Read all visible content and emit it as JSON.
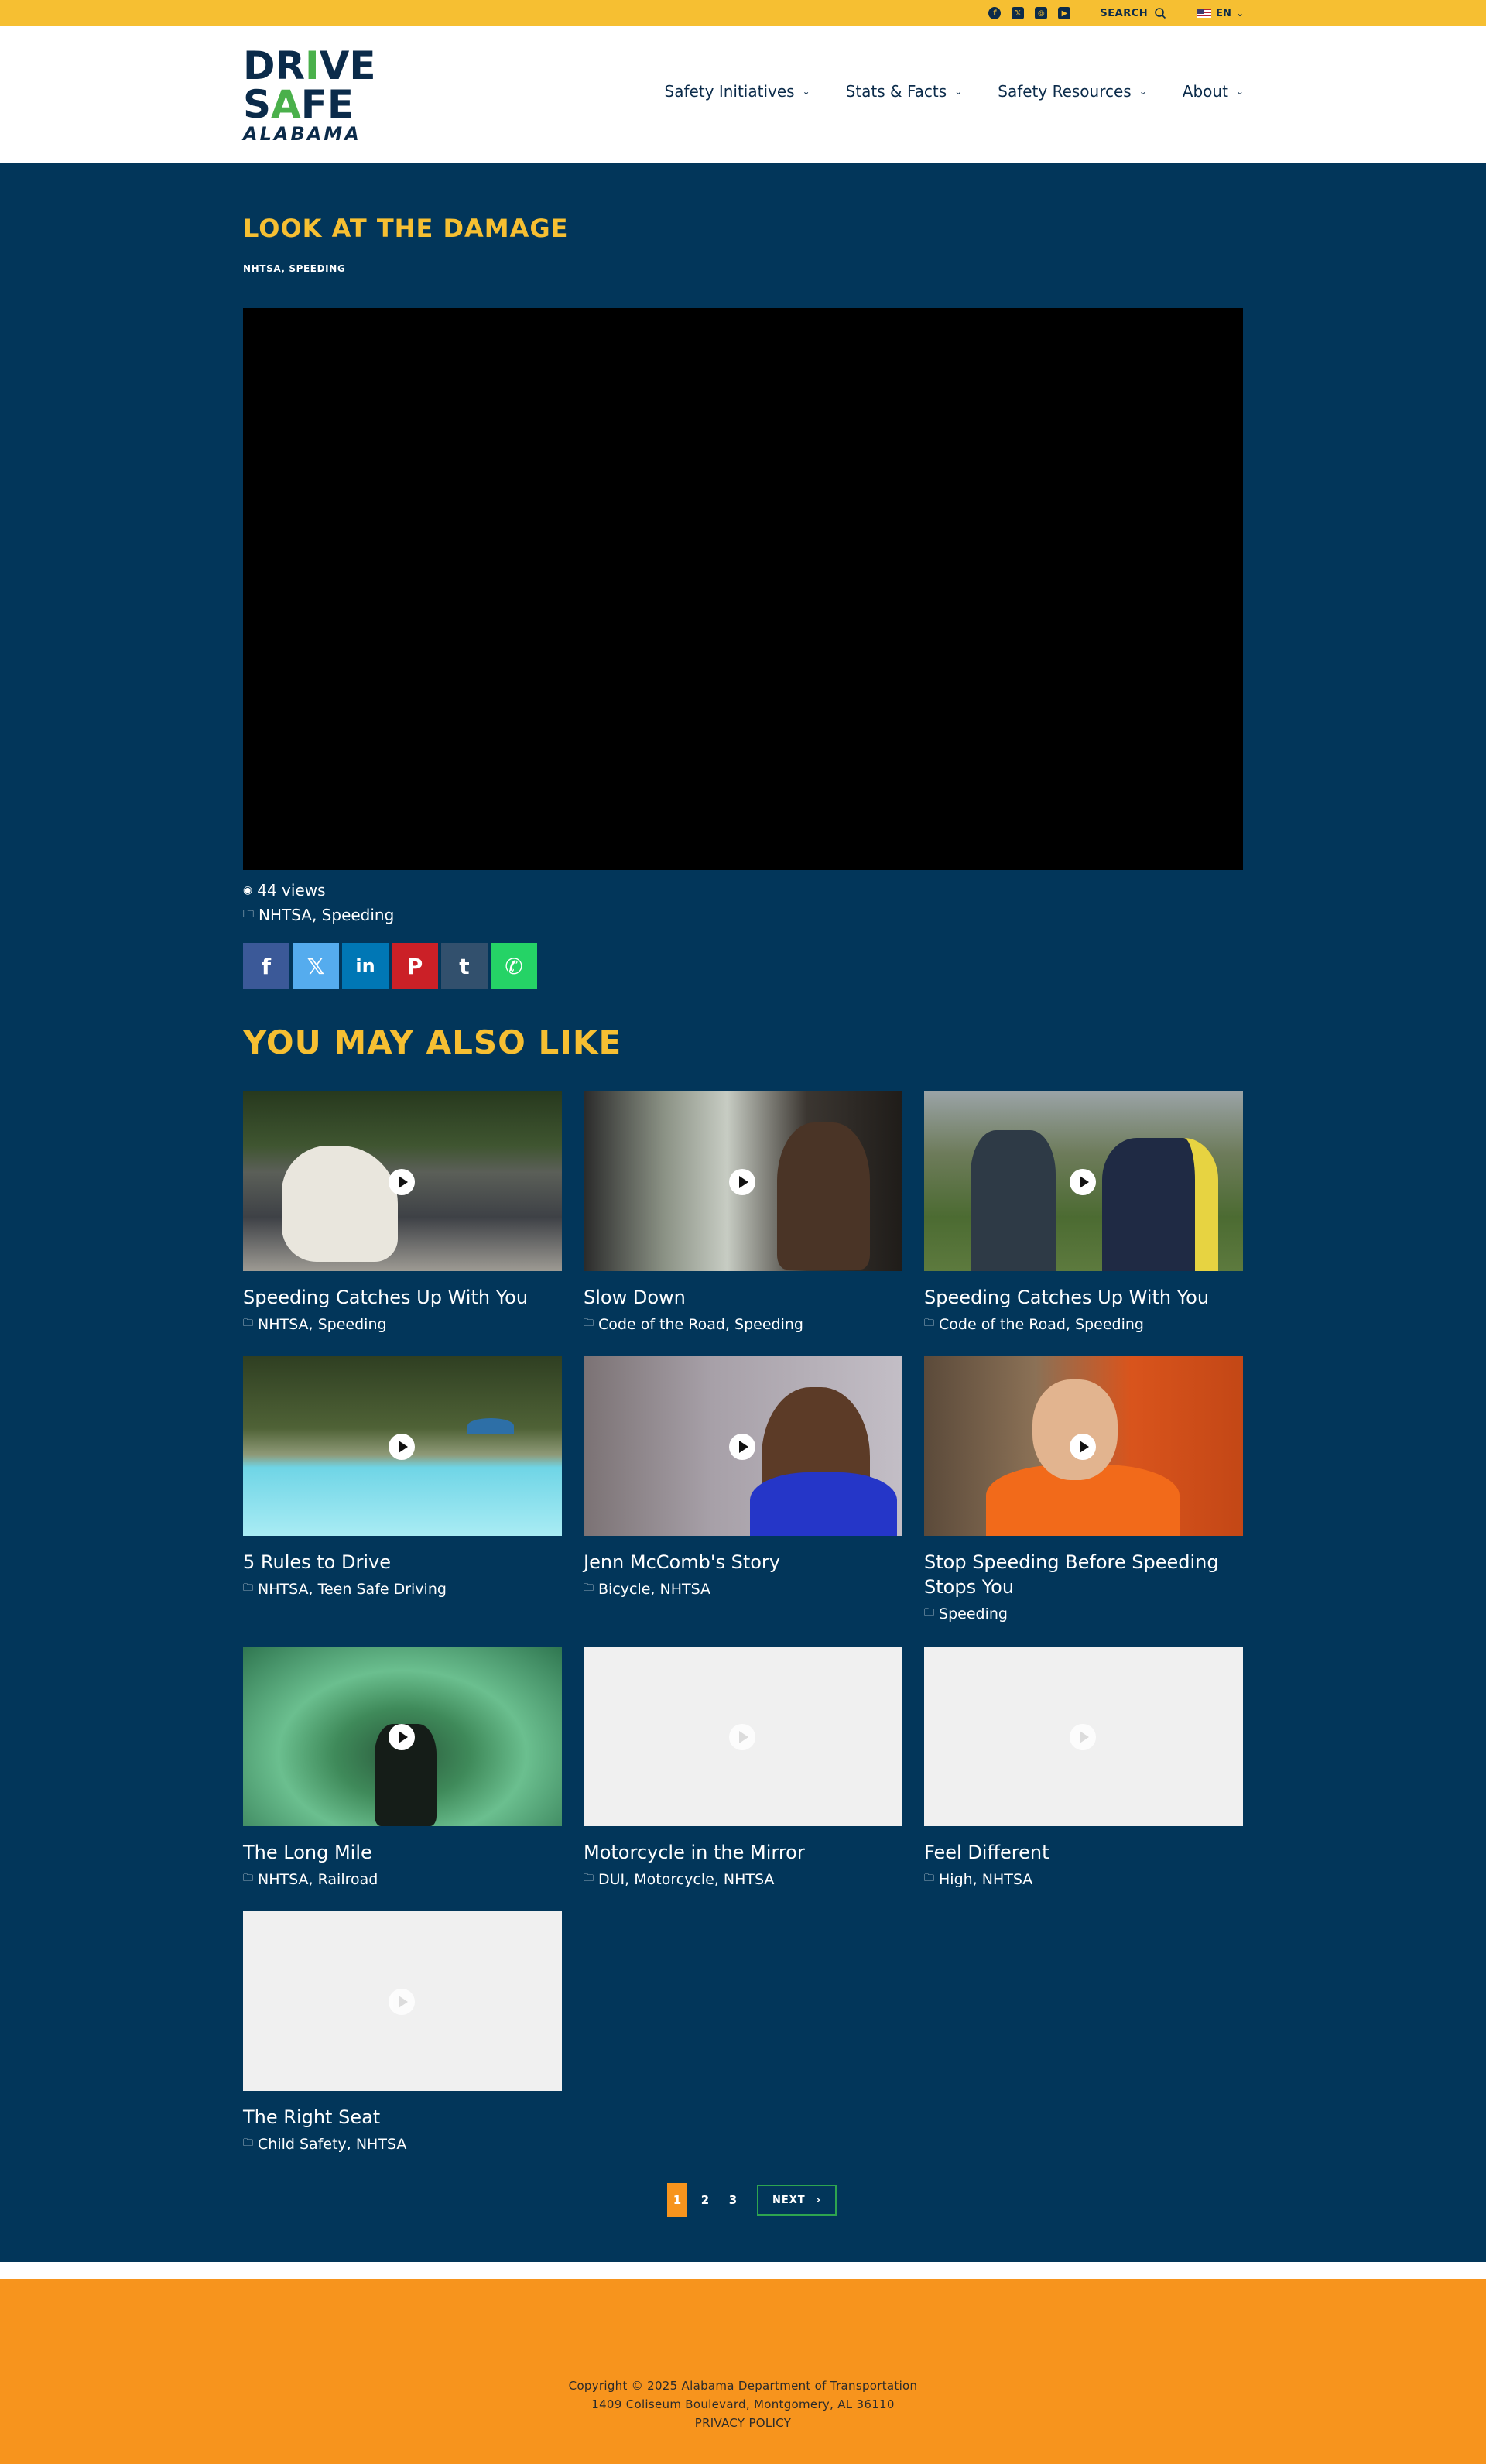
{
  "topbar": {
    "social": [
      {
        "icon": "facebook-icon",
        "glyph": "f"
      },
      {
        "icon": "x-icon",
        "glyph": "𝕏"
      },
      {
        "icon": "instagram-icon",
        "glyph": "◎"
      },
      {
        "icon": "youtube-icon",
        "glyph": "▶"
      }
    ],
    "search_label": "SEARCH",
    "lang_label": "EN"
  },
  "header": {
    "logo": {
      "line1_a": "DR",
      "line1_i": "I",
      "line1_b": "VE",
      "line2_a": "S",
      "line2_b": "A",
      "line2_c": "FE",
      "line3": "ALABAMA"
    },
    "nav": [
      {
        "label": "Safety Initiatives"
      },
      {
        "label": "Stats & Facts"
      },
      {
        "label": "Safety Resources"
      },
      {
        "label": "About"
      }
    ]
  },
  "post": {
    "title": "LOOK AT THE DAMAGE",
    "tags": "NHTSA, SPEEDING",
    "views": "44 views",
    "categories": "NHTSA, Speeding"
  },
  "share": [
    {
      "icon": "facebook-share-icon",
      "glyph": "f",
      "color": "#3b5998"
    },
    {
      "icon": "x-share-icon",
      "glyph": "𝕏",
      "color": "#55acee"
    },
    {
      "icon": "linkedin-share-icon",
      "glyph": "in",
      "color": "#0077b5"
    },
    {
      "icon": "pinterest-share-icon",
      "glyph": "P",
      "color": "#cb2027"
    },
    {
      "icon": "tumblr-share-icon",
      "glyph": "t",
      "color": "#32506d"
    },
    {
      "icon": "whatsapp-share-icon",
      "glyph": "✆",
      "color": "#25d366"
    }
  ],
  "related": {
    "heading": "YOU MAY ALSO LIKE",
    "items": [
      {
        "title": "Speeding Catches Up With You",
        "cats": "NHTSA, Speeding"
      },
      {
        "title": "Slow Down",
        "cats": "Code of the Road, Speeding"
      },
      {
        "title": "Speeding Catches Up With You",
        "cats": "Code of the Road, Speeding"
      },
      {
        "title": "5 Rules to Drive",
        "cats": "NHTSA, Teen Safe Driving"
      },
      {
        "title": "Jenn McComb's Story",
        "cats": "Bicycle, NHTSA"
      },
      {
        "title": "Stop Speeding Before Speeding Stops You",
        "cats": "Speeding"
      },
      {
        "title": "The Long Mile",
        "cats": "NHTSA, Railroad"
      },
      {
        "title": "Motorcycle in the Mirror",
        "cats": "DUI, Motorcycle, NHTSA"
      },
      {
        "title": "Feel Different",
        "cats": "High, NHTSA"
      },
      {
        "title": "The Right Seat",
        "cats": "Child Safety, NHTSA"
      }
    ]
  },
  "pagination": {
    "pages": [
      "1",
      "2",
      "3"
    ],
    "current": "1",
    "next_label": "NEXT"
  },
  "footer": {
    "copyright": "Copyright © 2025 Alabama Department of Transportation",
    "address": "1409 Coliseum Boulevard, Montgomery, AL 36110",
    "privacy": "PRIVACY POLICY"
  },
  "colors": {
    "topbar": "#f6bf32",
    "main_bg": "#02365a",
    "accent_yellow": "#f6bf32",
    "footer_orange": "#f7941d",
    "navy": "#0b2b4a"
  }
}
